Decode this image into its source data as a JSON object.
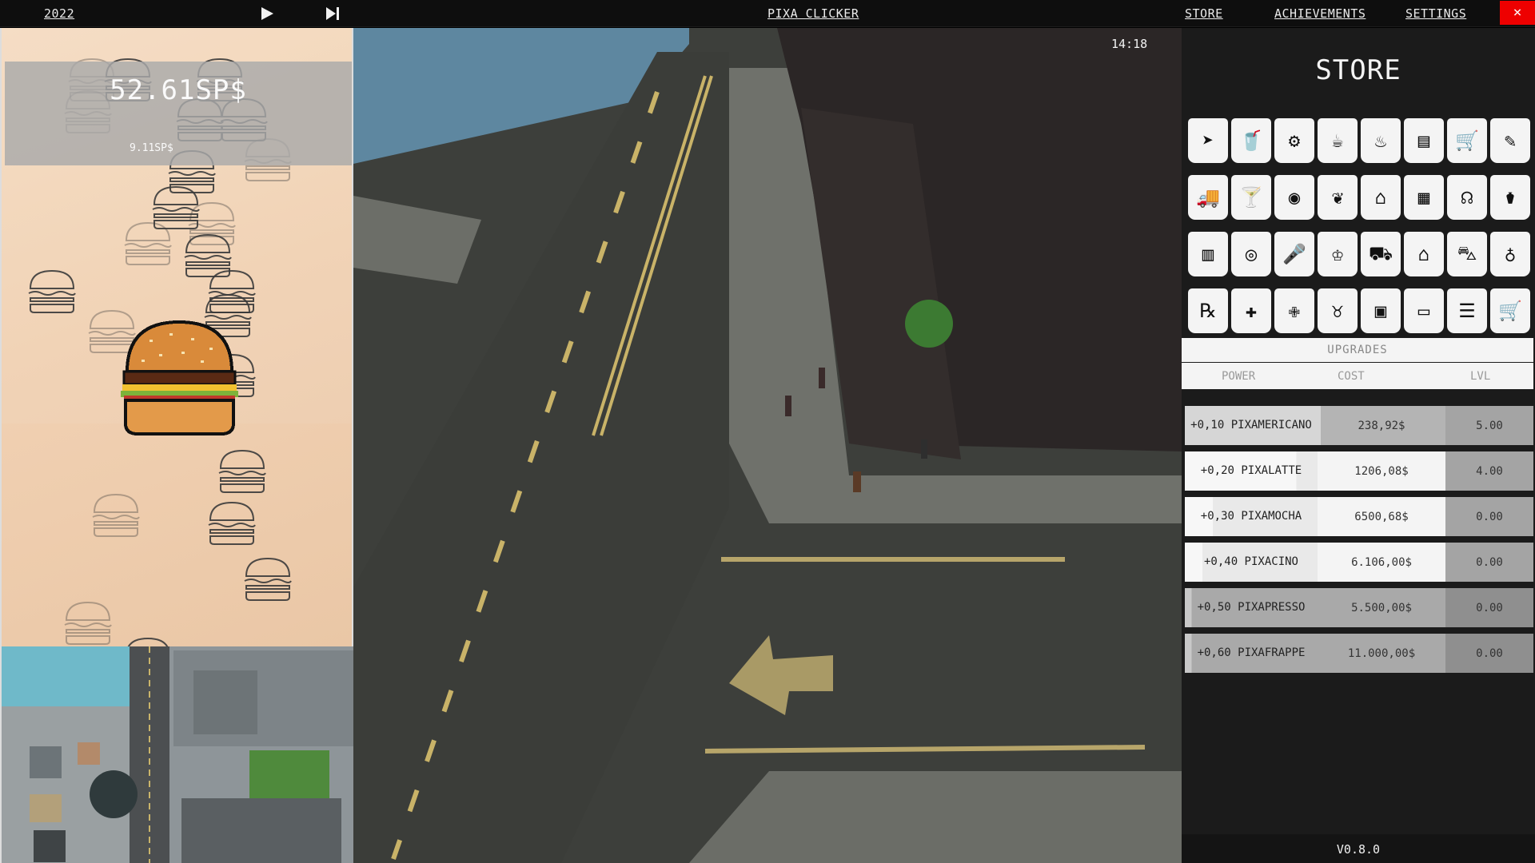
{
  "topbar": {
    "year_label": "2022",
    "play_icon": "play-icon",
    "skip_icon": "skip-forward-icon",
    "game_title": "PIXA CLICKER",
    "nav": {
      "store": "STORE",
      "achievements": "ACHIEVEMENTS",
      "settings": "SETTINGS"
    },
    "close_label": "×"
  },
  "clicker": {
    "balance": "52.61SP$",
    "rate": "9.11SP$"
  },
  "world": {
    "clock": "14:18"
  },
  "store": {
    "title": "STORE",
    "icons": [
      "cursor-icon",
      "cup-icon",
      "machine-icon",
      "coffee-mug-icon",
      "espresso-maker-icon",
      "menu-board-icon",
      "cart-icon",
      "pen-icon",
      "truck-icon",
      "cocktail-icon",
      "sack-icon",
      "coffee-bean-icon",
      "cafe-icon",
      "storefront-icon",
      "drums-icon",
      "bottle-icon",
      "barrel-icon",
      "vinyl-icon",
      "microphone-icon",
      "chef-icon",
      "food-truck-icon",
      "house-icon",
      "forklift-icon",
      "stethoscope-icon",
      "pills-icon",
      "medical-cross-icon",
      "ambulance-icon",
      "piggy-bank-icon",
      "vault-icon",
      "monitor-icon",
      "server-icon",
      "shopping-cart-icon"
    ],
    "upgrades_title": "UPGRADES",
    "columns": {
      "power": "POWER",
      "cost": "COST",
      "lvl": "LVL"
    },
    "upgrades": [
      {
        "power": "+0,10 PIXAMERICANO",
        "cost": "238,92$",
        "lvl": "5.00",
        "progress": 0.39
      },
      {
        "power": "+0,20 PIXALATTE",
        "cost": "1206,08$",
        "lvl": "4.00",
        "progress": 0.32
      },
      {
        "power": "+0,30 PIXAMOCHA",
        "cost": "6500,68$",
        "lvl": "0.00",
        "progress": 0.08
      },
      {
        "power": "+0,40 PIXACINO",
        "cost": "6.106,00$",
        "lvl": "0.00",
        "progress": 0.05
      },
      {
        "power": "+0,50 PIXAPRESSO",
        "cost": "5.500,00$",
        "lvl": "0.00",
        "progress": 0.02
      },
      {
        "power": "+0,60 PIXAFRAPPE",
        "cost": "11.000,00$",
        "lvl": "0.00",
        "progress": 0.02
      }
    ],
    "version": "V0.8.0"
  },
  "colors": {
    "close": "#e00000",
    "store_bg": "#1b1b1b",
    "clicker_bg": "#f1d1b3"
  }
}
